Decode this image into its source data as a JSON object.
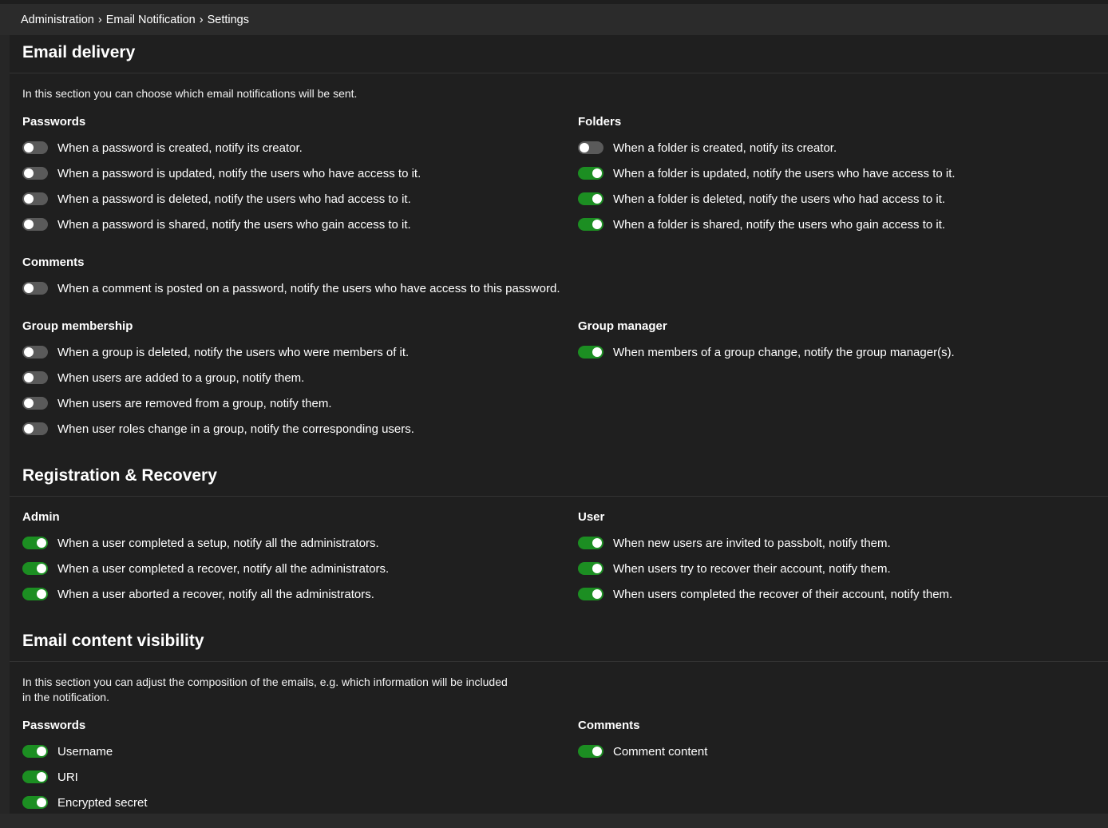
{
  "breadcrumb": [
    "Administration",
    "Email Notification",
    "Settings"
  ],
  "breadcrumb_separator": "›",
  "colors": {
    "toggle_on": "#1c8e22",
    "toggle_off": "#5a5a5a",
    "background": "#1f1f1f"
  },
  "email_delivery": {
    "title": "Email delivery",
    "description": "In this section you can choose which email notifications will be sent.",
    "passwords": {
      "title": "Passwords",
      "items": [
        {
          "label": "When a password is created, notify its creator.",
          "enabled": false
        },
        {
          "label": "When a password is updated, notify the users who have access to it.",
          "enabled": false
        },
        {
          "label": "When a password is deleted, notify the users who had access to it.",
          "enabled": false
        },
        {
          "label": "When a password is shared, notify the users who gain access to it.",
          "enabled": false
        }
      ]
    },
    "folders": {
      "title": "Folders",
      "items": [
        {
          "label": "When a folder is created, notify its creator.",
          "enabled": false
        },
        {
          "label": "When a folder is updated, notify the users who have access to it.",
          "enabled": true
        },
        {
          "label": "When a folder is deleted, notify the users who had access to it.",
          "enabled": true
        },
        {
          "label": "When a folder is shared, notify the users who gain access to it.",
          "enabled": true
        }
      ]
    },
    "comments": {
      "title": "Comments",
      "items": [
        {
          "label": "When a comment is posted on a password, notify the users who have access to this password.",
          "enabled": false
        }
      ]
    },
    "group_membership": {
      "title": "Group membership",
      "items": [
        {
          "label": "When a group is deleted, notify the users who were members of it.",
          "enabled": false
        },
        {
          "label": "When users are added to a group, notify them.",
          "enabled": false
        },
        {
          "label": "When users are removed from a group, notify them.",
          "enabled": false
        },
        {
          "label": "When user roles change in a group, notify the corresponding users.",
          "enabled": false
        }
      ]
    },
    "group_manager": {
      "title": "Group manager",
      "items": [
        {
          "label": "When members of a group change, notify the group manager(s).",
          "enabled": true
        }
      ]
    }
  },
  "registration_recovery": {
    "title": "Registration & Recovery",
    "admin": {
      "title": "Admin",
      "items": [
        {
          "label": "When a user completed a setup, notify all the administrators.",
          "enabled": true
        },
        {
          "label": "When a user completed a recover, notify all the administrators.",
          "enabled": true
        },
        {
          "label": "When a user aborted a recover, notify all the administrators.",
          "enabled": true
        }
      ]
    },
    "user": {
      "title": "User",
      "items": [
        {
          "label": "When new users are invited to passbolt, notify them.",
          "enabled": true
        },
        {
          "label": "When users try to recover their account, notify them.",
          "enabled": true
        },
        {
          "label": "When users completed the recover of their account, notify them.",
          "enabled": true
        }
      ]
    }
  },
  "content_visibility": {
    "title": "Email content visibility",
    "description": "In this section you can adjust the composition of the emails, e.g. which information will be included in the notification.",
    "passwords": {
      "title": "Passwords",
      "items": [
        {
          "label": "Username",
          "enabled": true
        },
        {
          "label": "URI",
          "enabled": true
        },
        {
          "label": "Encrypted secret",
          "enabled": true
        }
      ]
    },
    "comments": {
      "title": "Comments",
      "items": [
        {
          "label": "Comment content",
          "enabled": true
        }
      ]
    }
  }
}
